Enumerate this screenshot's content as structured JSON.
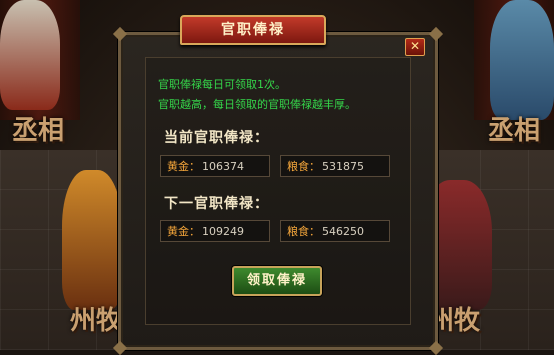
{
  "dialog": {
    "title": "官职俸禄",
    "close_label": "✕",
    "info_lines": [
      "官职俸禄每日可领取1次。",
      "官职越高，每日领取的官职俸禄越丰厚。"
    ],
    "current": {
      "heading": "当前官职俸禄：",
      "gold_label": "黄金：",
      "gold_value": "106374",
      "grain_label": "粮食：",
      "grain_value": "531875"
    },
    "next": {
      "heading": "下一官职俸禄：",
      "gold_label": "黄金：",
      "gold_value": "109249",
      "grain_label": "粮食：",
      "grain_value": "546250"
    },
    "claim_button": "领取俸禄"
  },
  "background": {
    "banner_left": "丞相",
    "banner_right": "丞相",
    "banner_bottom_left": "州牧",
    "banner_bottom_right": "州牧"
  },
  "colors": {
    "title_red": "#c23a2a",
    "info_green": "#35d64a",
    "label_orange": "#f2a43a",
    "button_green": "#3e8a2e",
    "frame_gold": "#c7a35a"
  }
}
